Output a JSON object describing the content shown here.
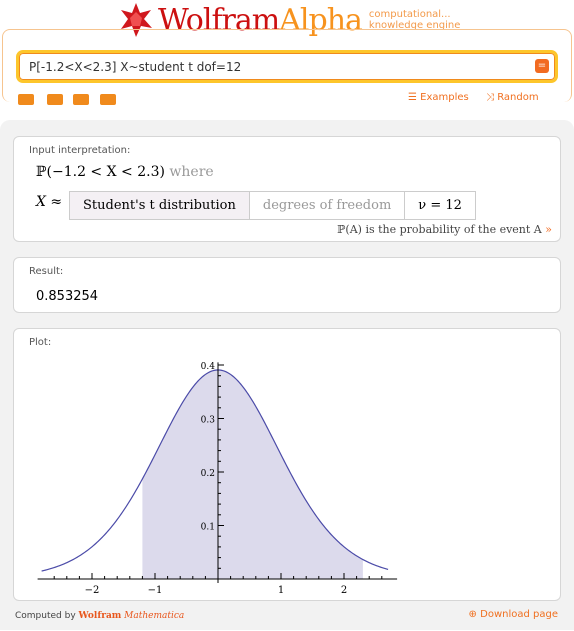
{
  "header": {
    "logo_wolfram": "Wolfram",
    "logo_alpha": "Alpha",
    "tagline_1": "computational...",
    "tagline_2": "knowledge engine"
  },
  "search": {
    "value": "P[-1.2<X<2.3] X~student t dof=12",
    "examples": "Examples",
    "random": "Random"
  },
  "pods": {
    "input": {
      "title": "Input interpretation:",
      "line1": "ℙ(−1.2 < X < 2.3)",
      "where": "where",
      "x_approx": "X ≈",
      "dist": "Student's t distribution",
      "param_label": "degrees of freedom",
      "param_value": "ν = 12",
      "note": "ℙ(A) is the probability of the event A",
      "note_arrow": "»"
    },
    "result": {
      "title": "Result:",
      "value": "0.853254"
    },
    "plot": {
      "title": "Plot:"
    }
  },
  "chart_data": {
    "type": "area",
    "distribution": "Student's t",
    "dof": 12,
    "shaded_interval": [
      -1.2,
      2.3
    ],
    "xlim": [
      -2.8,
      2.7
    ],
    "ylim": [
      0,
      0.4
    ],
    "x_ticks": [
      "−2",
      "−1",
      "1",
      "2"
    ],
    "x_tick_values": [
      -2,
      -1,
      1,
      2
    ],
    "y_ticks": [
      "0.1",
      "0.2",
      "0.3",
      "0.4"
    ],
    "y_tick_values": [
      0.1,
      0.2,
      0.3,
      0.4
    ],
    "line_color": "#4b4ba8",
    "fill_color": "#dcdaec"
  },
  "footer": {
    "computed_by": "Computed by",
    "brand": "Wolfram",
    "product": "Mathematica",
    "download": "Download page"
  }
}
